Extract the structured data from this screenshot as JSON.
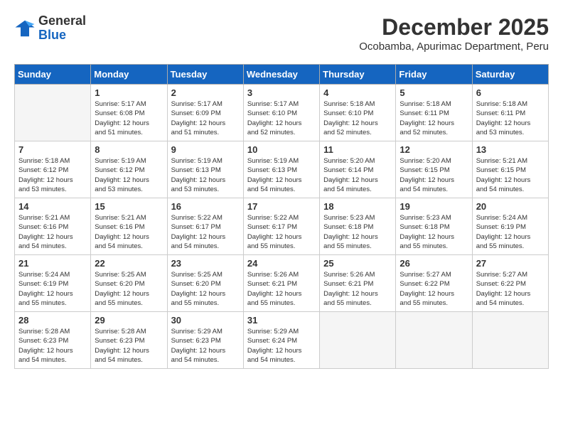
{
  "logo": {
    "general": "General",
    "blue": "Blue"
  },
  "title": "December 2025",
  "subtitle": "Ocobamba, Apurimac Department, Peru",
  "weekdays": [
    "Sunday",
    "Monday",
    "Tuesday",
    "Wednesday",
    "Thursday",
    "Friday",
    "Saturday"
  ],
  "weeks": [
    [
      {
        "day": "",
        "info": ""
      },
      {
        "day": "1",
        "info": "Sunrise: 5:17 AM\nSunset: 6:08 PM\nDaylight: 12 hours\nand 51 minutes."
      },
      {
        "day": "2",
        "info": "Sunrise: 5:17 AM\nSunset: 6:09 PM\nDaylight: 12 hours\nand 51 minutes."
      },
      {
        "day": "3",
        "info": "Sunrise: 5:17 AM\nSunset: 6:10 PM\nDaylight: 12 hours\nand 52 minutes."
      },
      {
        "day": "4",
        "info": "Sunrise: 5:18 AM\nSunset: 6:10 PM\nDaylight: 12 hours\nand 52 minutes."
      },
      {
        "day": "5",
        "info": "Sunrise: 5:18 AM\nSunset: 6:11 PM\nDaylight: 12 hours\nand 52 minutes."
      },
      {
        "day": "6",
        "info": "Sunrise: 5:18 AM\nSunset: 6:11 PM\nDaylight: 12 hours\nand 53 minutes."
      }
    ],
    [
      {
        "day": "7",
        "info": "Sunrise: 5:18 AM\nSunset: 6:12 PM\nDaylight: 12 hours\nand 53 minutes."
      },
      {
        "day": "8",
        "info": "Sunrise: 5:19 AM\nSunset: 6:12 PM\nDaylight: 12 hours\nand 53 minutes."
      },
      {
        "day": "9",
        "info": "Sunrise: 5:19 AM\nSunset: 6:13 PM\nDaylight: 12 hours\nand 53 minutes."
      },
      {
        "day": "10",
        "info": "Sunrise: 5:19 AM\nSunset: 6:13 PM\nDaylight: 12 hours\nand 54 minutes."
      },
      {
        "day": "11",
        "info": "Sunrise: 5:20 AM\nSunset: 6:14 PM\nDaylight: 12 hours\nand 54 minutes."
      },
      {
        "day": "12",
        "info": "Sunrise: 5:20 AM\nSunset: 6:15 PM\nDaylight: 12 hours\nand 54 minutes."
      },
      {
        "day": "13",
        "info": "Sunrise: 5:21 AM\nSunset: 6:15 PM\nDaylight: 12 hours\nand 54 minutes."
      }
    ],
    [
      {
        "day": "14",
        "info": "Sunrise: 5:21 AM\nSunset: 6:16 PM\nDaylight: 12 hours\nand 54 minutes."
      },
      {
        "day": "15",
        "info": "Sunrise: 5:21 AM\nSunset: 6:16 PM\nDaylight: 12 hours\nand 54 minutes."
      },
      {
        "day": "16",
        "info": "Sunrise: 5:22 AM\nSunset: 6:17 PM\nDaylight: 12 hours\nand 54 minutes."
      },
      {
        "day": "17",
        "info": "Sunrise: 5:22 AM\nSunset: 6:17 PM\nDaylight: 12 hours\nand 55 minutes."
      },
      {
        "day": "18",
        "info": "Sunrise: 5:23 AM\nSunset: 6:18 PM\nDaylight: 12 hours\nand 55 minutes."
      },
      {
        "day": "19",
        "info": "Sunrise: 5:23 AM\nSunset: 6:18 PM\nDaylight: 12 hours\nand 55 minutes."
      },
      {
        "day": "20",
        "info": "Sunrise: 5:24 AM\nSunset: 6:19 PM\nDaylight: 12 hours\nand 55 minutes."
      }
    ],
    [
      {
        "day": "21",
        "info": "Sunrise: 5:24 AM\nSunset: 6:19 PM\nDaylight: 12 hours\nand 55 minutes."
      },
      {
        "day": "22",
        "info": "Sunrise: 5:25 AM\nSunset: 6:20 PM\nDaylight: 12 hours\nand 55 minutes."
      },
      {
        "day": "23",
        "info": "Sunrise: 5:25 AM\nSunset: 6:20 PM\nDaylight: 12 hours\nand 55 minutes."
      },
      {
        "day": "24",
        "info": "Sunrise: 5:26 AM\nSunset: 6:21 PM\nDaylight: 12 hours\nand 55 minutes."
      },
      {
        "day": "25",
        "info": "Sunrise: 5:26 AM\nSunset: 6:21 PM\nDaylight: 12 hours\nand 55 minutes."
      },
      {
        "day": "26",
        "info": "Sunrise: 5:27 AM\nSunset: 6:22 PM\nDaylight: 12 hours\nand 55 minutes."
      },
      {
        "day": "27",
        "info": "Sunrise: 5:27 AM\nSunset: 6:22 PM\nDaylight: 12 hours\nand 54 minutes."
      }
    ],
    [
      {
        "day": "28",
        "info": "Sunrise: 5:28 AM\nSunset: 6:23 PM\nDaylight: 12 hours\nand 54 minutes."
      },
      {
        "day": "29",
        "info": "Sunrise: 5:28 AM\nSunset: 6:23 PM\nDaylight: 12 hours\nand 54 minutes."
      },
      {
        "day": "30",
        "info": "Sunrise: 5:29 AM\nSunset: 6:23 PM\nDaylight: 12 hours\nand 54 minutes."
      },
      {
        "day": "31",
        "info": "Sunrise: 5:29 AM\nSunset: 6:24 PM\nDaylight: 12 hours\nand 54 minutes."
      },
      {
        "day": "",
        "info": ""
      },
      {
        "day": "",
        "info": ""
      },
      {
        "day": "",
        "info": ""
      }
    ]
  ]
}
